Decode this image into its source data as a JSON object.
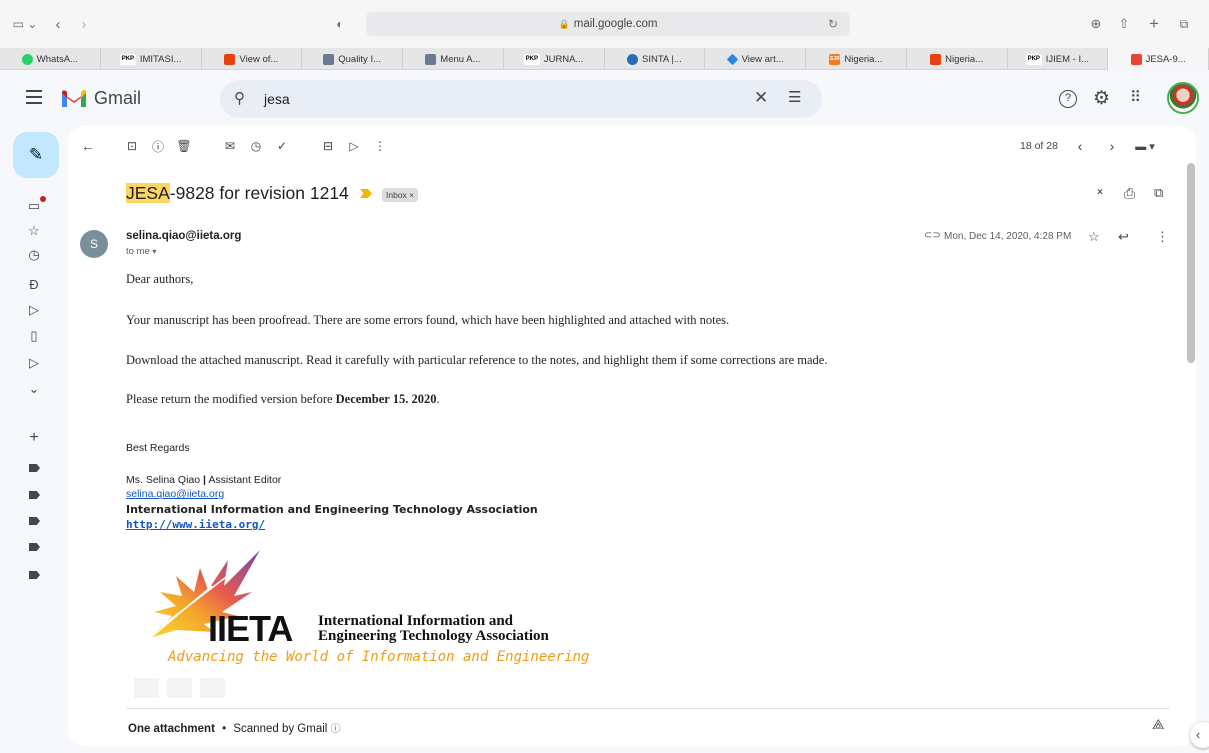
{
  "browser": {
    "url": "mail.google.com",
    "tabs": [
      {
        "label": "WhatsA...",
        "icon": "whatsapp-icon",
        "color": "#25d366"
      },
      {
        "label": "IMITASI...",
        "icon": "pkp-icon",
        "color": "#ffffff"
      },
      {
        "label": "View of...",
        "icon": "sun-logo-icon",
        "color": "#e8430f"
      },
      {
        "label": "Quality I...",
        "icon": "quality-icon",
        "color": "#6b7a8f"
      },
      {
        "label": "Menu A...",
        "icon": "menu-icon",
        "color": "#6b7a8f"
      },
      {
        "label": "JURNA...",
        "icon": "pkp-icon",
        "color": "#ffffff"
      },
      {
        "label": "SINTA |...",
        "icon": "sinta-icon",
        "color": "#2b6cb0"
      },
      {
        "label": "View art...",
        "icon": "diamond-icon",
        "color": "#2e86de"
      },
      {
        "label": "Nigeria...",
        "icon": "sjr-icon",
        "color": "#f47c20"
      },
      {
        "label": "Nigeria...",
        "icon": "sun-logo-icon",
        "color": "#e8430f"
      },
      {
        "label": "IJIEM - I...",
        "icon": "pkp-icon",
        "color": "#ffffff"
      },
      {
        "label": "JESA-9...",
        "icon": "gmail-icon",
        "color": "#ea4335"
      }
    ],
    "pkp_text": "PKP",
    "sjr_text": "SJR"
  },
  "gmail": {
    "app_name": "Gmail",
    "search_value": "jesa"
  },
  "toolbar": {
    "counter": "18 of 28"
  },
  "email": {
    "subject_highlight": "JESA",
    "subject_rest": "-9828 for revision 1214",
    "label": "Inbox",
    "label_close": "×",
    "sender_initial": "S",
    "sender": "selina.qiao@iieta.org",
    "to": "to me",
    "date": "Mon, Dec 14, 2020, 4:28 PM",
    "greeting": "Dear authors,",
    "p1": "Your manuscript has been proofread. There are some errors found, which have been highlighted and attached with notes.",
    "p2": "Download the attached manuscript. Read it carefully with particular reference to the notes, and highlight them if some corrections are made.",
    "p3_prefix": "Please return the modified version before ",
    "p3_bold": "December 15. 2020",
    "p3_suffix": ".",
    "regards": "Best Regards",
    "sig_name": "Ms. Selina Qiao",
    "sig_sep": "|",
    "sig_role": "Assistant Editor",
    "sig_email": "selina.qiao@iieta.org",
    "sig_org": "International Information and Engineering Technology Association",
    "sig_url": "http://www.iieta.org/",
    "logo_text": "IIETA",
    "logo_line1": "International Information and",
    "logo_line2": "Engineering Technology Association",
    "logo_tagline": "Advancing the World of Information and Engineering"
  },
  "attachments": {
    "summary": "One attachment",
    "separator": "•",
    "scanned": "Scanned by Gmail"
  },
  "colors": {
    "accent": "#0b57d0",
    "highlight": "#fcd663",
    "compose": "#c2e7ff",
    "gmail_red": "#ea4335",
    "unread_dot": "#c5221f"
  }
}
